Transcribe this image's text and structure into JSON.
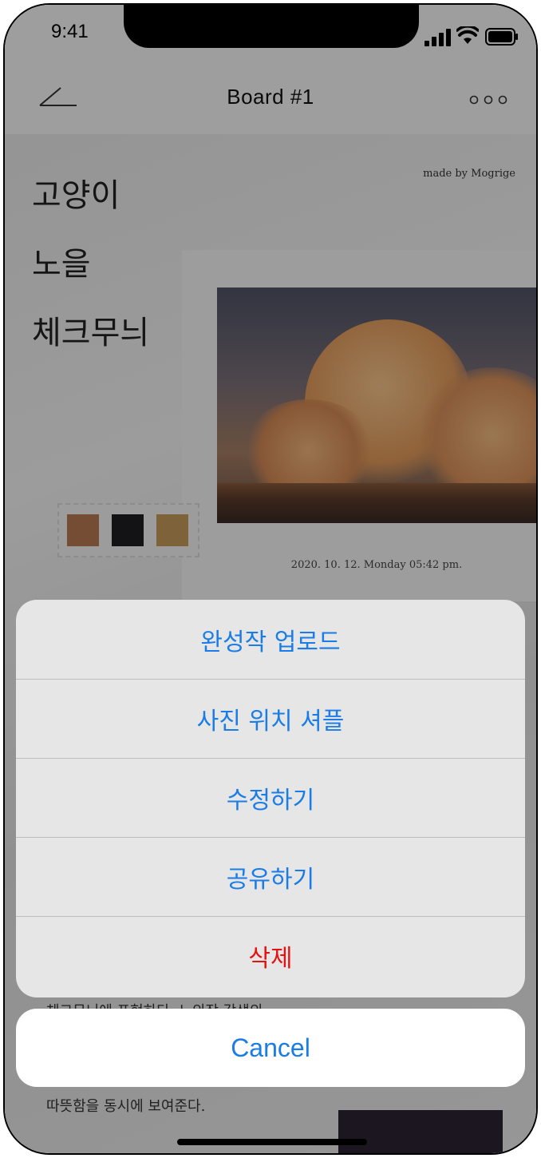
{
  "status_bar": {
    "time": "9:41"
  },
  "nav": {
    "title": "Board #1"
  },
  "board": {
    "keywords": [
      "고양이",
      "노을",
      "체크무늬"
    ],
    "credit": "made by Mogrige",
    "date": "2020. 10. 12. Monday 05:42 pm.",
    "swatches": [
      "#b77752",
      "#1f1f21",
      "#c59a5a"
    ],
    "caption_top": "체크무늬에 표현하다. 노의장 각색의",
    "caption_bottom": "따뜻함을 동시에 보여준다."
  },
  "action_sheet": {
    "actions": [
      "완성작 업로드",
      "사진 위치 셔플",
      "수정하기",
      "공유하기",
      "삭제"
    ],
    "cancel": "Cancel"
  },
  "colors": {
    "accent": "#1a7ce6",
    "destructive": "#e6120f"
  }
}
